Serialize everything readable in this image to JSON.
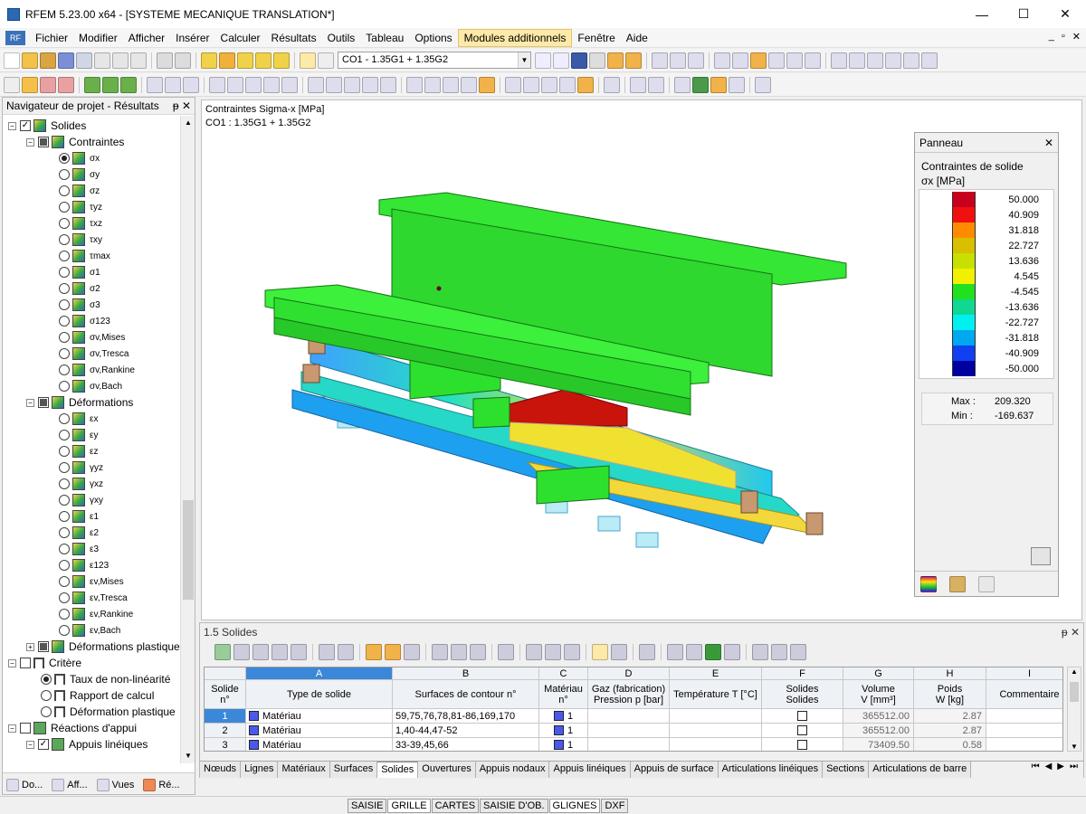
{
  "window": {
    "title": "RFEM 5.23.00 x64 - [SYSTEME MECANIQUE TRANSLATION*]",
    "min": "—",
    "max": "☐",
    "close": "✕"
  },
  "menu": {
    "logo": "RF",
    "items": [
      "Fichier",
      "Modifier",
      "Afficher",
      "Insérer",
      "Calculer",
      "Résultats",
      "Outils",
      "Tableau",
      "Options",
      "Modules additionnels",
      "Fenêtre",
      "Aide"
    ],
    "active_index": 9,
    "mdi": [
      "_",
      "▫",
      "✕"
    ]
  },
  "toolbar": {
    "loadcase": "CO1 - 1.35G1 + 1.35G2"
  },
  "navigator": {
    "title": "Navigateur de projet - Résultats",
    "pin": "ᵽ",
    "close": "✕",
    "tree": {
      "solides": "Solides",
      "contraintes": "Contraintes",
      "stresses": [
        "σx",
        "σy",
        "σz",
        "τyz",
        "τxz",
        "τxy",
        "τmax",
        "σ1",
        "σ2",
        "σ3",
        "σ123",
        "σv,Mises",
        "σv,Tresca",
        "σv,Rankine",
        "σv,Bach"
      ],
      "deformations": "Déformations",
      "strains": [
        "εx",
        "εy",
        "εz",
        "γyz",
        "γxz",
        "γxy",
        "ε1",
        "ε2",
        "ε3",
        "ε123",
        "εv,Mises",
        "εv,Tresca",
        "εv,Rankine",
        "εv,Bach"
      ],
      "plastic": "Déformations plastiques",
      "critere": "Critère",
      "criteria": [
        "Taux de non-linéarité",
        "Rapport de calcul",
        "Déformation plastique"
      ],
      "reactions": "Réactions d'appui",
      "appuis_lineiques": "Appuis linéiques"
    },
    "tabs": [
      "Do...",
      "Aff...",
      "Vues",
      "Ré..."
    ]
  },
  "viewport": {
    "line1": "Contraintes Sigma-x [MPa]",
    "line2": "CO1 : 1.35G1 + 1.35G2"
  },
  "panel": {
    "title": "Panneau",
    "close": "✕",
    "heading": "Contraintes de solide",
    "unit": "σx [MPa]",
    "legend": [
      {
        "value": "50.000",
        "color": "#c8001e"
      },
      {
        "value": "40.909",
        "color": "#f01010"
      },
      {
        "value": "31.818",
        "color": "#ff8c00"
      },
      {
        "value": "22.727",
        "color": "#d8c000"
      },
      {
        "value": "13.636",
        "color": "#c8e000"
      },
      {
        "value": "4.545",
        "color": "#f0f000"
      },
      {
        "value": "-4.545",
        "color": "#20e020"
      },
      {
        "value": "-13.636",
        "color": "#10d890"
      },
      {
        "value": "-22.727",
        "color": "#00f0f0"
      },
      {
        "value": "-31.818",
        "color": "#00a8f0"
      },
      {
        "value": "-40.909",
        "color": "#1040f0"
      },
      {
        "value": "-50.000",
        "color": "#0000a0"
      }
    ],
    "max_label": "Max :",
    "max_value": "209.320",
    "min_label": "Min :",
    "min_value": "-169.637"
  },
  "table": {
    "title": "1.5 Solides",
    "pin": "ᵽ",
    "close": "✕",
    "col_letters": [
      "A",
      "B",
      "C",
      "D",
      "E",
      "F",
      "G",
      "H",
      "I"
    ],
    "row_header_1": "Solide",
    "row_header_2": "n°",
    "headers_top": [
      "",
      "",
      "Matériau",
      "Gaz (fabrication)",
      "",
      "Solides",
      "Volume",
      "Poids",
      ""
    ],
    "headers_bottom": [
      "Type de solide",
      "Surfaces de contour n°",
      "n°",
      "Pression p [bar]",
      "Température T [°C]",
      "Solides",
      "V [mm³]",
      "W [kg]",
      "Commentaire"
    ],
    "rows": [
      {
        "n": "1",
        "type": "Matériau",
        "surfaces": "59,75,76,78,81-86,169,170",
        "mat": "1",
        "volume": "365512.00",
        "poids": "2.87"
      },
      {
        "n": "2",
        "type": "Matériau",
        "surfaces": "1,40-44,47-52",
        "mat": "1",
        "volume": "365512.00",
        "poids": "2.87"
      },
      {
        "n": "3",
        "type": "Matériau",
        "surfaces": "33-39,45,66",
        "mat": "1",
        "volume": "73409.50",
        "poids": "0.58"
      }
    ],
    "tabs": [
      "Nœuds",
      "Lignes",
      "Matériaux",
      "Surfaces",
      "Solides",
      "Ouvertures",
      "Appuis nodaux",
      "Appuis linéiques",
      "Appuis de surface",
      "Articulations linéiques",
      "Sections",
      "Articulations de barre"
    ],
    "active_tab": 4
  },
  "status": {
    "buttons": [
      "SAISIE",
      "GRILLE",
      "CARTES",
      "SAISIE D'OB.",
      "GLIGNES",
      "DXF"
    ]
  }
}
